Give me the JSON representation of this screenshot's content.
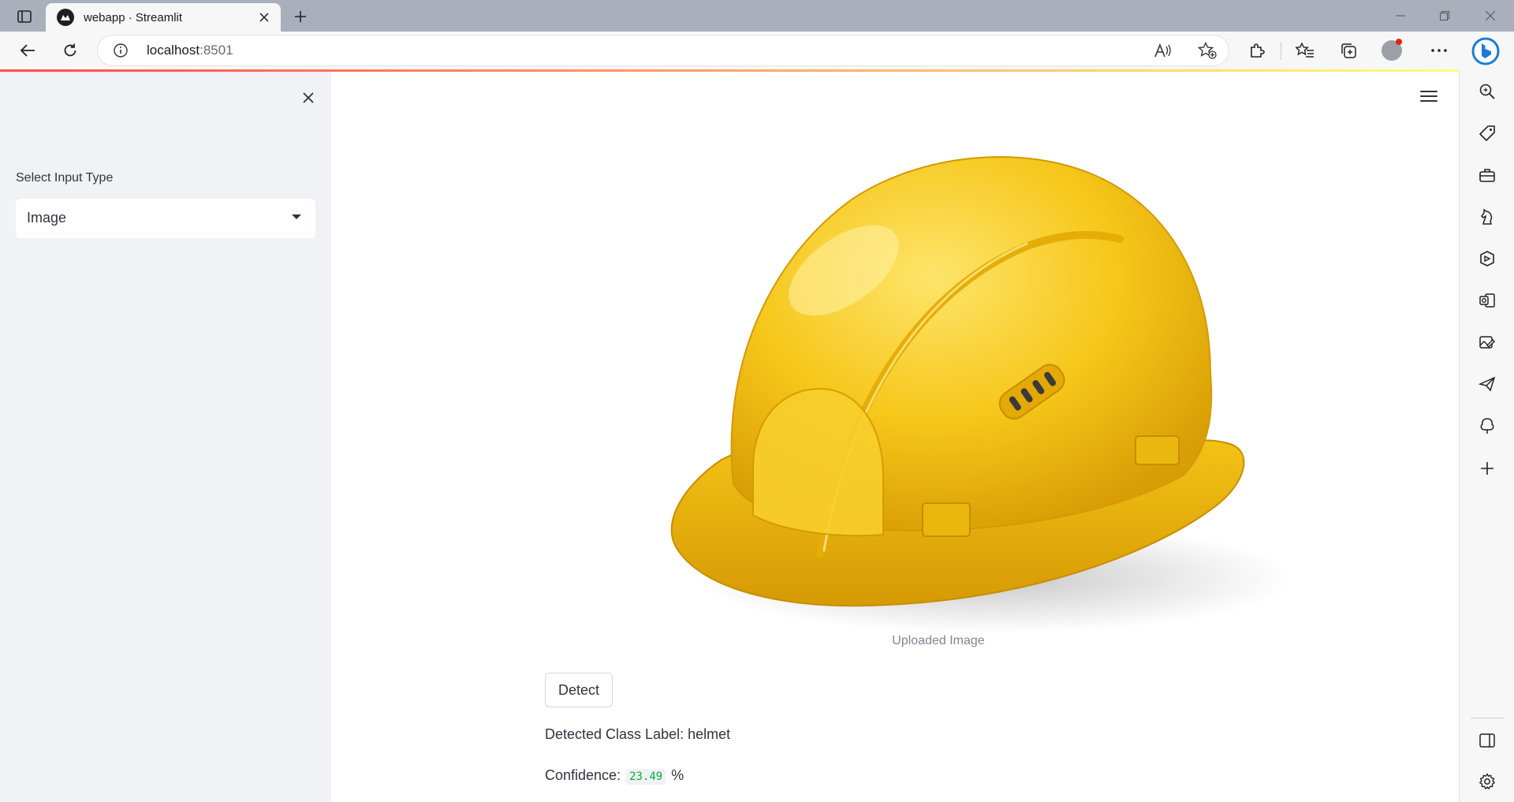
{
  "browser": {
    "tab_title": "webapp · Streamlit",
    "address_host": "localhost",
    "address_port": ":8501"
  },
  "sidebar": {
    "label": "Select Input Type",
    "select_value": "Image"
  },
  "main": {
    "image_caption": "Uploaded Image",
    "detect_button": "Detect",
    "detected_label_text": "Detected Class Label: helmet",
    "confidence_label": "Confidence:",
    "confidence_value": "23.49",
    "confidence_unit": "%"
  },
  "colors": {
    "sidebar_bg": "#f0f2f6",
    "helmet": "#f5c518",
    "confidence_green": "#09ab3b",
    "decoration_start": "#ff4b4b",
    "decoration_end": "#fffd80"
  },
  "icons": {
    "tab_actions": "tab-actions-icon",
    "favicon": "streamlit-favicon",
    "tab_close": "close-icon",
    "new_tab": "plus-icon",
    "back": "back-arrow-icon",
    "refresh": "refresh-icon",
    "site_info": "info-icon",
    "read_aloud": "read-aloud-icon",
    "add_favorite": "star-add-icon",
    "extensions": "puzzle-icon",
    "favorites": "favorites-icon",
    "collections": "collections-icon",
    "profile": "avatar",
    "more": "ellipsis-icon",
    "copilot": "bing-icon",
    "sidebar_close": "close-icon",
    "main_menu": "hamburger-icon",
    "rail": [
      "search-icon",
      "tag-icon",
      "briefcase-icon",
      "chess-icon",
      "office-icon",
      "outlook-icon",
      "image-edit-icon",
      "send-icon",
      "tree-icon",
      "plus-icon",
      "sidebar-layout-icon",
      "gear-icon"
    ]
  }
}
